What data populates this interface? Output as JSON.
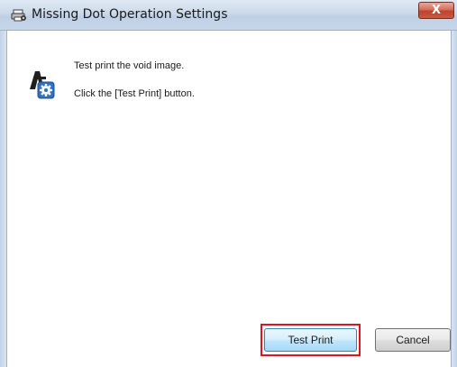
{
  "window": {
    "title": "Missing Dot Operation Settings",
    "close_label": "X"
  },
  "content": {
    "instruction_line1": "Test print the void image.",
    "instruction_line2": "Click the [Test Print] button."
  },
  "buttons": {
    "test_print": "Test Print",
    "cancel": "Cancel"
  },
  "icons": {
    "title": "printer-gear-icon",
    "main": "print-settings-gear-icon"
  },
  "colors": {
    "highlight": "#e0141e",
    "close_button": "#c1412b"
  }
}
